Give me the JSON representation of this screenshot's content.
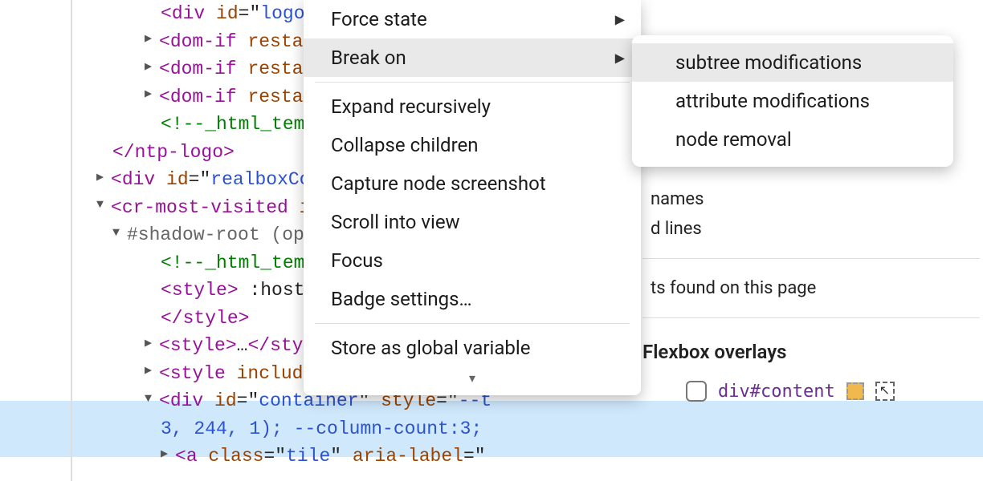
{
  "dom": {
    "l0": {
      "arrow": "▶",
      "tag_open": "<",
      "tag": "dom-if",
      "attr": " restam"
    },
    "l1": {
      "tag_open": "<",
      "tag": "div",
      "attr_name": " id",
      "attr_eq": "=",
      "attr_q": "\"",
      "attr_val": "logo",
      "attr_end": "\""
    },
    "l2": {
      "arrow": "▶",
      "tag_open": "<",
      "tag": "dom-if",
      "attr": " restam"
    },
    "l3": {
      "arrow": "▶",
      "tag_open": "<",
      "tag": "dom-if",
      "attr": " restam"
    },
    "l4": {
      "comment": "<!--_html_temp"
    },
    "l5": {
      "tag_open": "</",
      "tag": "ntp-logo",
      "tag_close": ">"
    },
    "l6": {
      "arrow": "▶",
      "tag_open": "<",
      "tag": "div",
      "attr_name": " id",
      "attr_eq": "=",
      "attr_q": "\"",
      "attr_val": "realboxCo"
    },
    "l7": {
      "arrow": "▼",
      "tag_open": "<",
      "tag": "cr-most-visited",
      "attr": " i"
    },
    "l8": {
      "arrow": "▼",
      "text": "#shadow-root (op"
    },
    "l9": {
      "comment": "<!--_html_temp"
    },
    "l10": {
      "tag_open": "<",
      "tag": "style",
      "tag_close": ">",
      "text": " :host("
    },
    "l11": {
      "tag_open": "</",
      "tag": "style",
      "tag_close": ">"
    },
    "l12": {
      "arrow": "▶",
      "tag_open": "<",
      "tag": "style",
      "tag_close": ">",
      "ell": "…",
      "close_open": "</",
      "close_tag": "styl"
    },
    "l13": {
      "arrow": "▶",
      "tag_open": "<",
      "tag": "style",
      "attr": " include"
    },
    "l14": {
      "arrow": "▼",
      "tag_open": "<",
      "tag": "div",
      "attr_id_name": " id",
      "eq": "=",
      "q1": "\"",
      "id_val": "container",
      "q2": "\"",
      "attr_style_name": " style",
      "q3": "\"",
      "style_val": "--t"
    },
    "l15": {
      "cont": "3, 244, 1); --column-count:3;"
    },
    "l16": {
      "arrow": "▶",
      "tag_open": "<",
      "tag": "a",
      "attr_cls": " class",
      "eq": "=",
      "q1": "\"",
      "cls_val": "tile",
      "q2": "\"",
      "attr_aria": " aria-label",
      "q3": "\""
    }
  },
  "menu": {
    "force_state": "Force state",
    "break_on": "Break on",
    "expand": "Expand recursively",
    "collapse": "Collapse children",
    "capture": "Capture node screenshot",
    "scroll": "Scroll into view",
    "focus": "Focus",
    "badge": "Badge settings…",
    "store": "Store as global variable"
  },
  "submenu": {
    "subtree": "subtree modifications",
    "attr": "attribute modifications",
    "node": "node removal"
  },
  "right": {
    "names": "names",
    "lines": "d lines",
    "found": "ts found on this page",
    "flexbox": "Flexbox overlays",
    "selector": "div#content"
  }
}
